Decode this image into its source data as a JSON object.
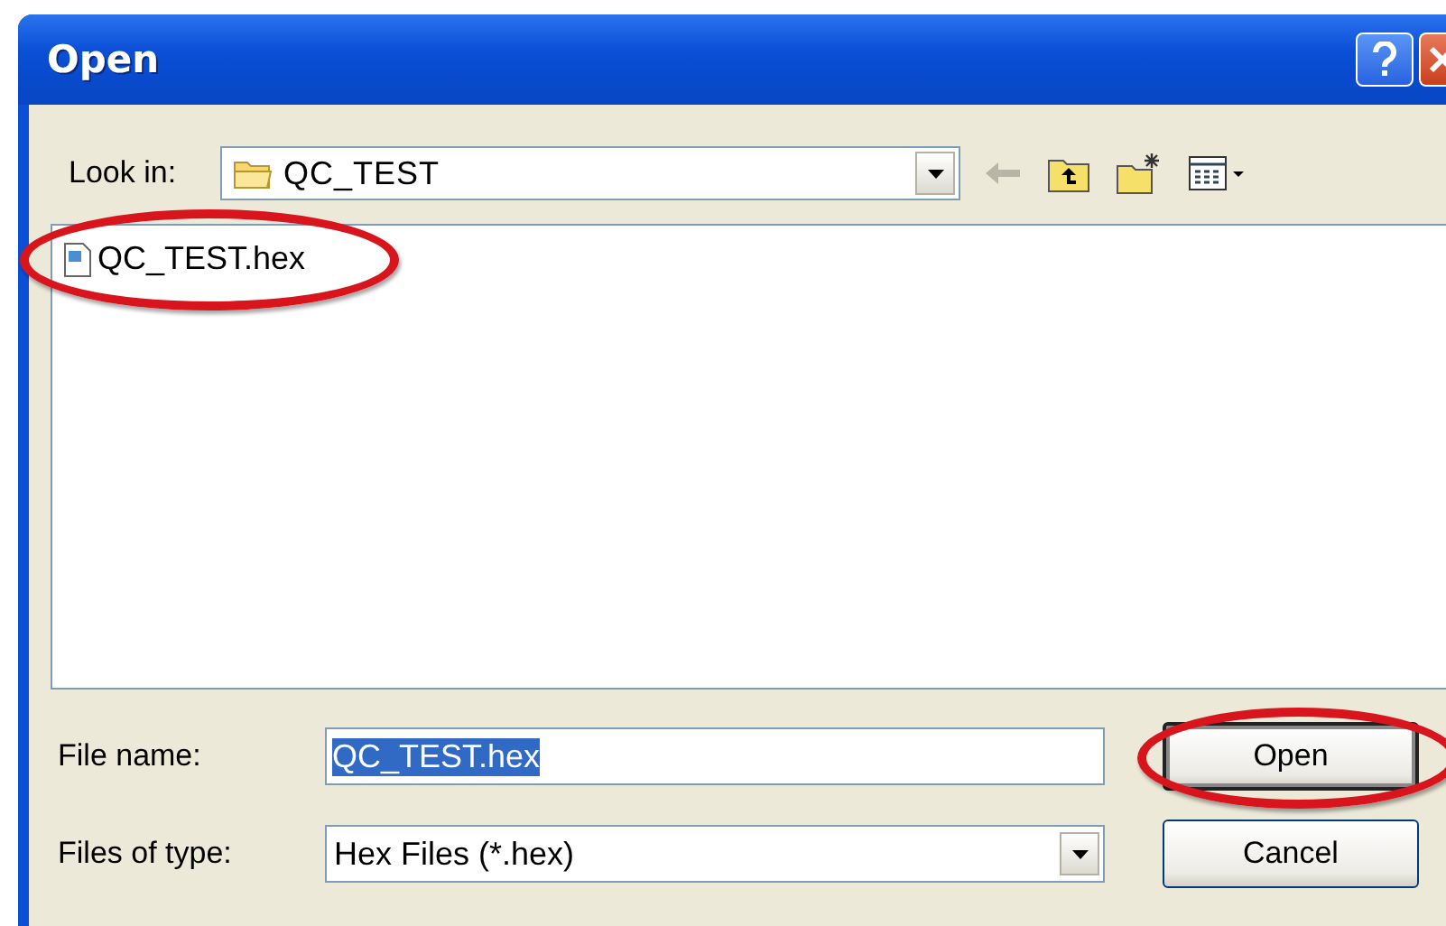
{
  "window": {
    "title": "Open"
  },
  "look_in": {
    "label": "Look in:",
    "value": "QC_TEST"
  },
  "files": [
    {
      "name": "QC_TEST.hex",
      "circled": true
    }
  ],
  "file_name": {
    "label": "File name:",
    "value": "QC_TEST.hex",
    "value_selected": true
  },
  "file_type": {
    "label": "Files of type:",
    "value": "Hex Files (*.hex)"
  },
  "buttons": [
    {
      "label": "Open",
      "circled": true
    },
    {
      "label": "Cancel",
      "circled": false
    }
  ]
}
